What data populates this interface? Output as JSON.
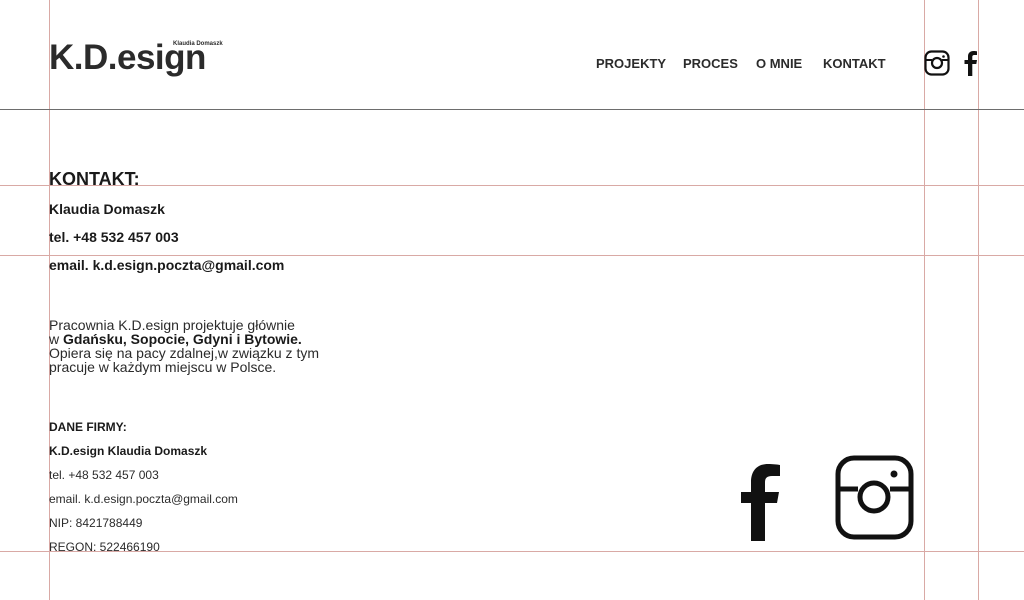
{
  "logo": {
    "main": "K.D.esign",
    "sub": "Klaudia Domaszk"
  },
  "nav": [
    {
      "label": "PROJEKTY"
    },
    {
      "label": "PROCES"
    },
    {
      "label": "O MNIE"
    },
    {
      "label": "KONTAKT"
    }
  ],
  "social": {
    "instagram_icon": "instagram-icon",
    "facebook_icon": "facebook-icon"
  },
  "contact": {
    "title": "KONTAKT:",
    "name": "Klaudia Domaszk",
    "phone": "tel. +48 532 457 003",
    "email": "email. k.d.esign.poczta@gmail.com"
  },
  "about": {
    "line1": "Pracownia K.D.esign projektuje głównie",
    "line2_prefix": "w ",
    "line2_bold": "Gdańsku, Sopocie, Gdyni i Bytowie.",
    "line3": "Opiera się na pacy zdalnej,w związku z tym",
    "line4": " pracuje w każdym miejscu w Polsce."
  },
  "company": {
    "label": "DANE FIRMY:",
    "name": "K.D.esign Klaudia Domaszk",
    "phone": "tel. +48 532 457 003",
    "email": "email. k.d.esign.poczta@gmail.com",
    "nip": "NIP:  8421788449",
    "regon": "REGON:  522466190"
  },
  "colors": {
    "guide": "#d9a9a5",
    "text": "#1a1a1a",
    "header_rule": "#6d6d6d"
  }
}
